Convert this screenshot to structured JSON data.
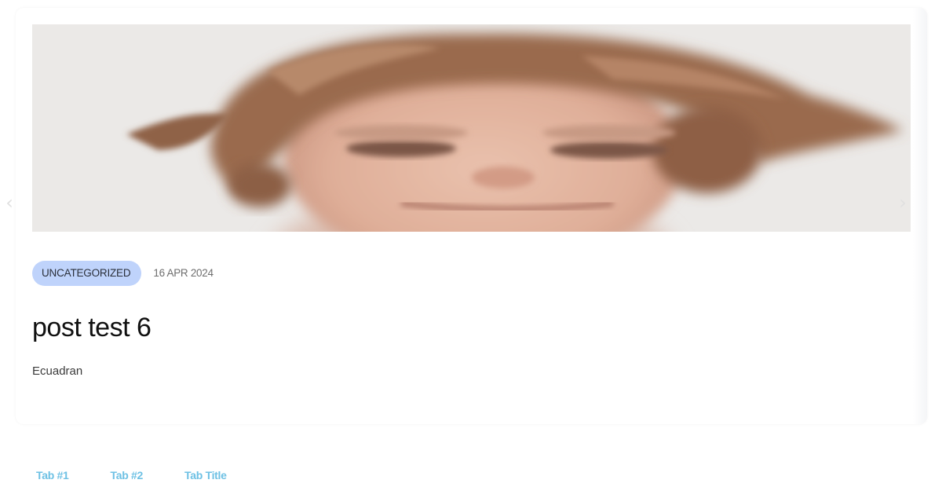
{
  "post": {
    "category": "UNCATEGORIZED",
    "date": "16 APR 2024",
    "title": "post test 6",
    "excerpt": "Ecuadran",
    "image": "portrait-photo"
  },
  "carousel": {
    "prev_icon": "chevron-left-icon",
    "next_icon": "chevron-right-icon",
    "prev_glyph": "‹",
    "next_glyph": "›"
  },
  "tabs": [
    {
      "label": "Tab #1"
    },
    {
      "label": "Tab #2"
    },
    {
      "label": "Tab Title"
    }
  ],
  "colors": {
    "badge_bg": "#bfd3fb",
    "tab_text": "#6ec1e4",
    "title_text": "#111111"
  }
}
